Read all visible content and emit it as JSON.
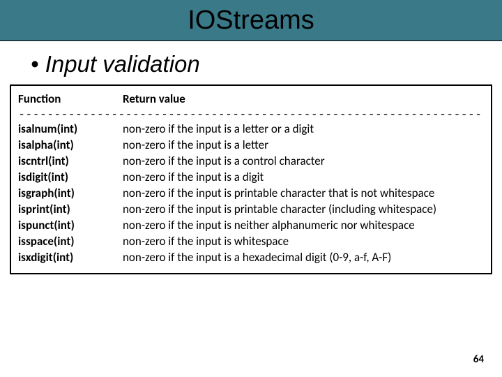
{
  "title": "IOStreams",
  "bullet": "Input validation",
  "headers": {
    "function": "Function",
    "retval": "Return value"
  },
  "dashes": "-------------------------------------------------------------------------------------------------------------------------",
  "rows": [
    {
      "fn": "isalnum(int)",
      "desc": "non-zero if the input is a letter or a digit"
    },
    {
      "fn": "isalpha(int)",
      "desc": "non-zero if the input is a letter"
    },
    {
      "fn": "iscntrl(int)",
      "desc": "non-zero if the input is a control character"
    },
    {
      "fn": "isdigit(int)",
      "desc": "non-zero if the input is a digit"
    },
    {
      "fn": "isgraph(int)",
      "desc": "non-zero if the input is printable character that is not whitespace"
    },
    {
      "fn": "isprint(int)",
      "desc": "non-zero if the input is printable character (including whitespace)"
    },
    {
      "fn": "ispunct(int)",
      "desc": "non-zero if the input is neither alphanumeric nor whitespace"
    },
    {
      "fn": "isspace(int)",
      "desc": "non-zero if the input is whitespace"
    },
    {
      "fn": "isxdigit(int)",
      "desc": "non-zero if the input is a hexadecimal digit (0-9, a-f, A-F)"
    }
  ],
  "page": "64"
}
